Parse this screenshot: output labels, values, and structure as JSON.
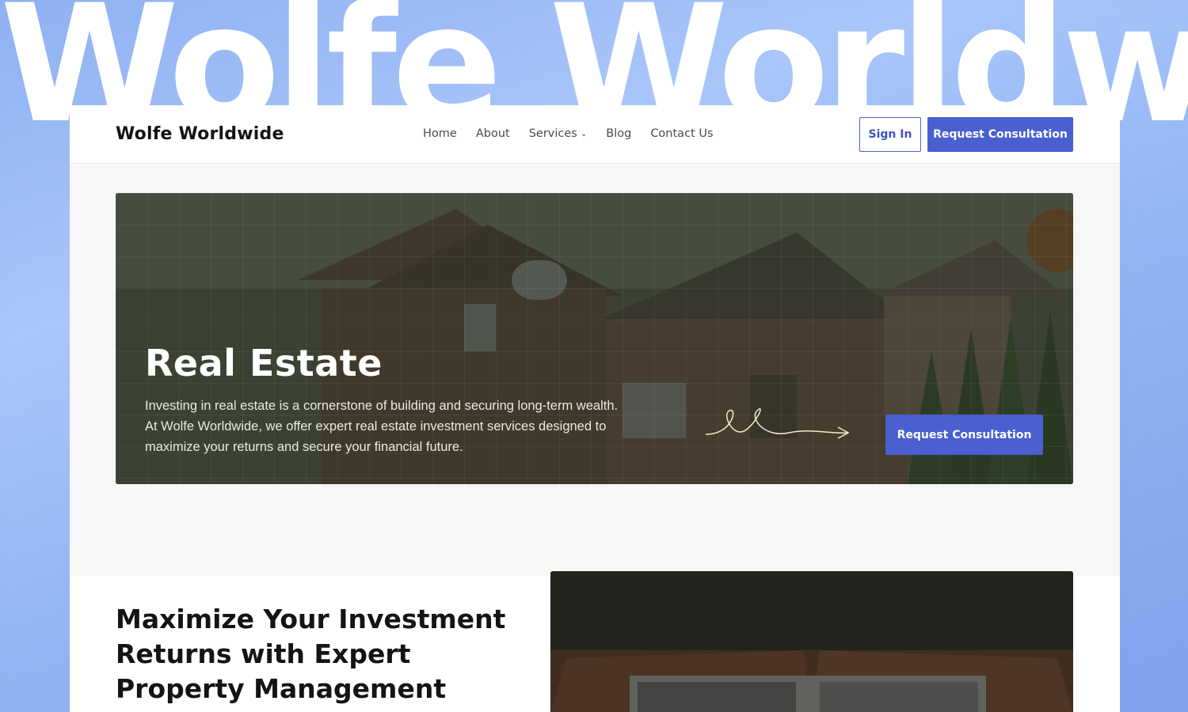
{
  "background": {
    "wordmark": "Wolfe Worldwide"
  },
  "nav": {
    "logo": "Wolfe Worldwide",
    "items": [
      {
        "label": "Home"
      },
      {
        "label": "About"
      },
      {
        "label": "Services",
        "has_dropdown": true
      },
      {
        "label": "Blog"
      },
      {
        "label": "Contact Us"
      }
    ],
    "signin_label": "Sign In",
    "consult_label": "Request Consultation"
  },
  "hero": {
    "title": "Real Estate",
    "text": "Investing in real estate is a cornerstone of building and securing long-term wealth. At Wolfe Worldwide, we offer expert real estate investment services designed to maximize your returns and secure your financial future.",
    "button_label": "Request Consultation"
  },
  "section": {
    "title": "Maximize Your Investment Returns with Expert Property Management"
  },
  "colors": {
    "accent": "#4a5fd0",
    "background": "#93b6f4",
    "text_dark": "#141414"
  }
}
